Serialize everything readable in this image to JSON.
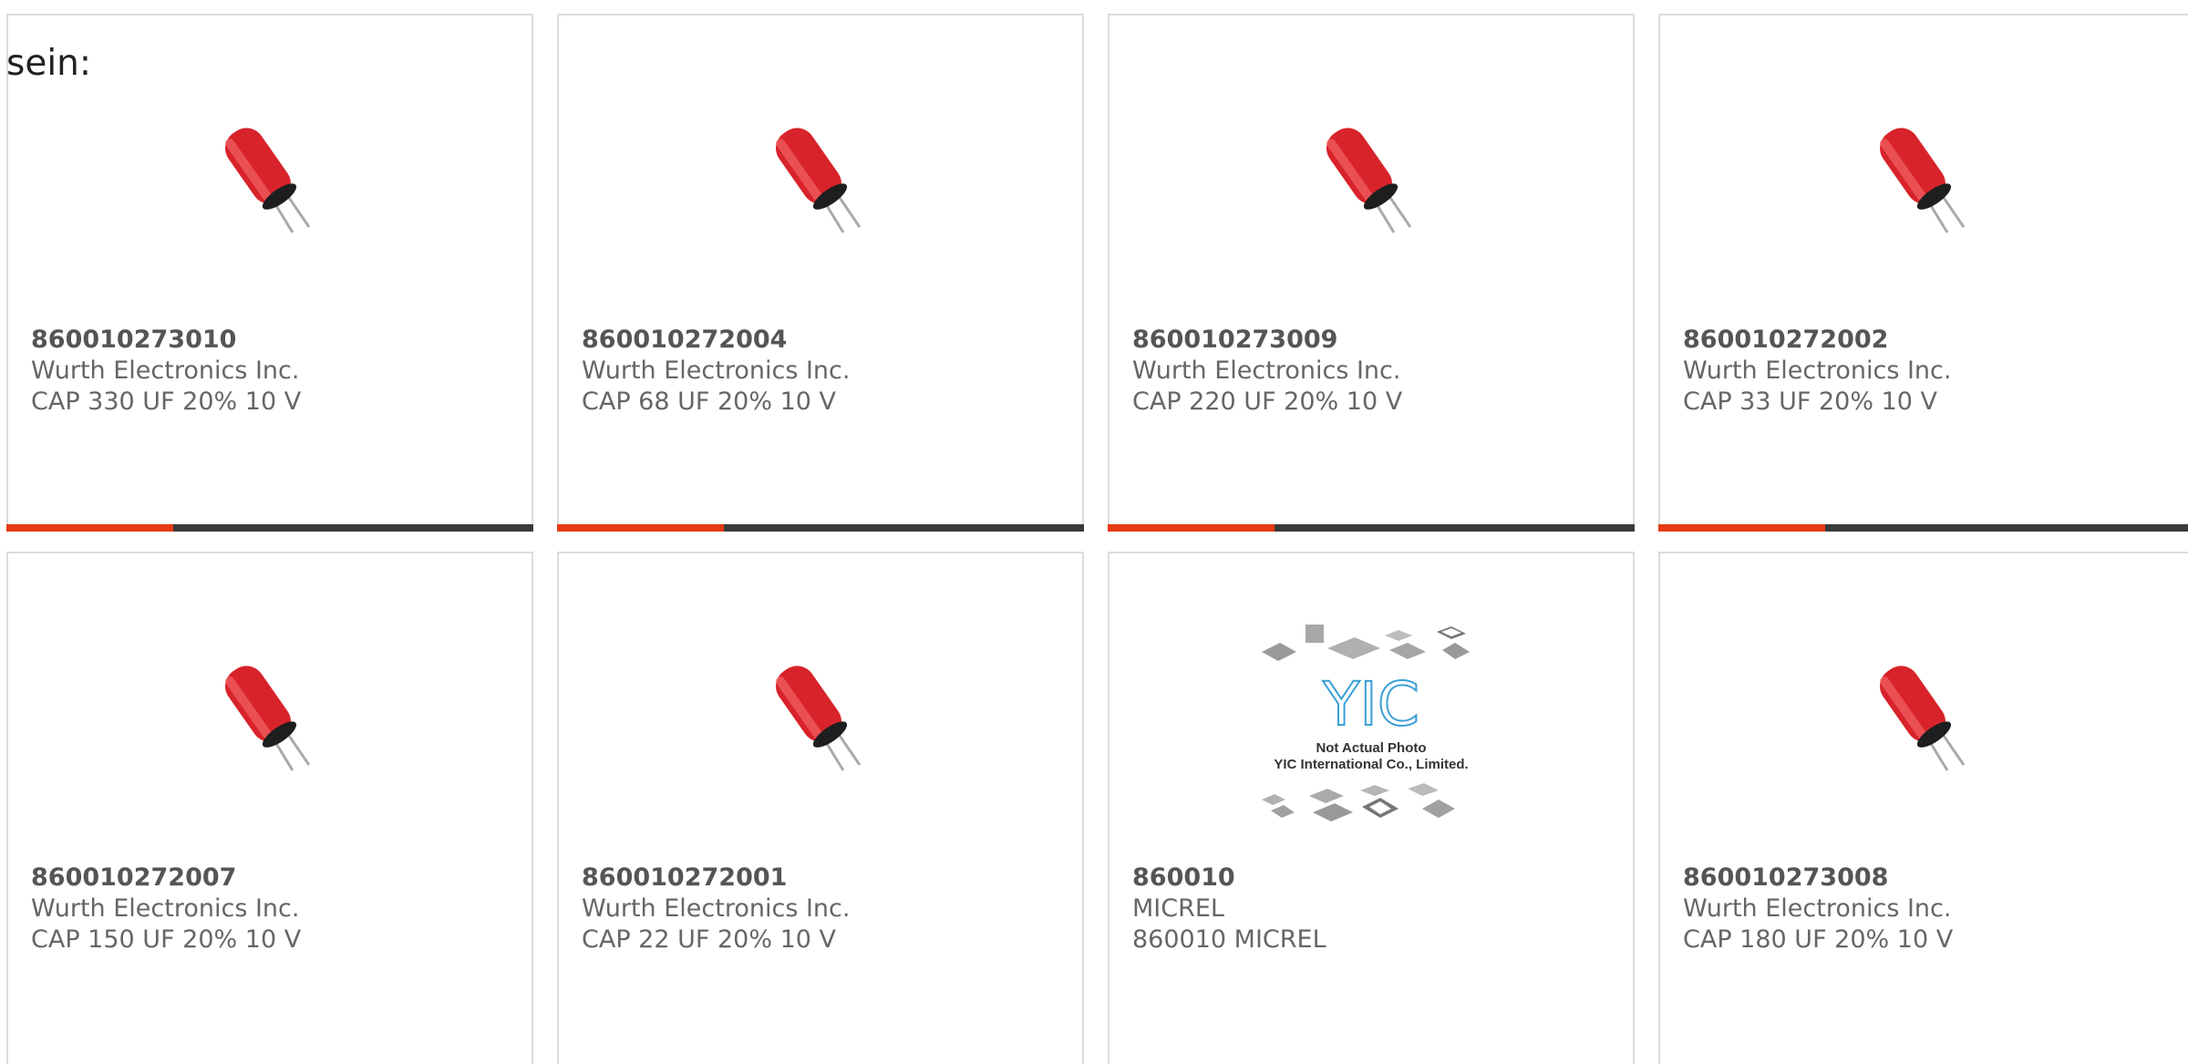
{
  "intro_text": "sein:",
  "colors": {
    "card_border": "#dcdcdc",
    "bar_dark": "#3a3a3a",
    "bar_accent": "#e63b12",
    "text": "#666666"
  },
  "products": [
    {
      "part_number": "860010273010",
      "manufacturer": "Wurth Electronics Inc.",
      "description": "CAP 330 UF 20% 10 V",
      "image": "capacitor-image"
    },
    {
      "part_number": "860010272004",
      "manufacturer": "Wurth Electronics Inc.",
      "description": "CAP 68 UF 20% 10 V",
      "image": "capacitor-image"
    },
    {
      "part_number": "860010273009",
      "manufacturer": "Wurth Electronics Inc.",
      "description": "CAP 220 UF 20% 10 V",
      "image": "capacitor-image"
    },
    {
      "part_number": "860010272002",
      "manufacturer": "Wurth Electronics Inc.",
      "description": "CAP 33 UF 20% 10 V",
      "image": "capacitor-image"
    },
    {
      "part_number": "860010272007",
      "manufacturer": "Wurth Electronics Inc.",
      "description": "CAP 150 UF 20% 10 V",
      "image": "capacitor-image"
    },
    {
      "part_number": "860010272001",
      "manufacturer": "Wurth Electronics Inc.",
      "description": "CAP 22 UF 20% 10 V",
      "image": "capacitor-image"
    },
    {
      "part_number": "860010",
      "manufacturer": "MICREL",
      "description": "860010 MICREL",
      "image": "placeholder-chips-image",
      "placeholder_line1": "Not Actual Photo",
      "placeholder_line2": "YIC International Co., Limited."
    },
    {
      "part_number": "860010273008",
      "manufacturer": "Wurth Electronics Inc.",
      "description": "CAP 180 UF 20% 10 V",
      "image": "capacitor-image"
    }
  ]
}
